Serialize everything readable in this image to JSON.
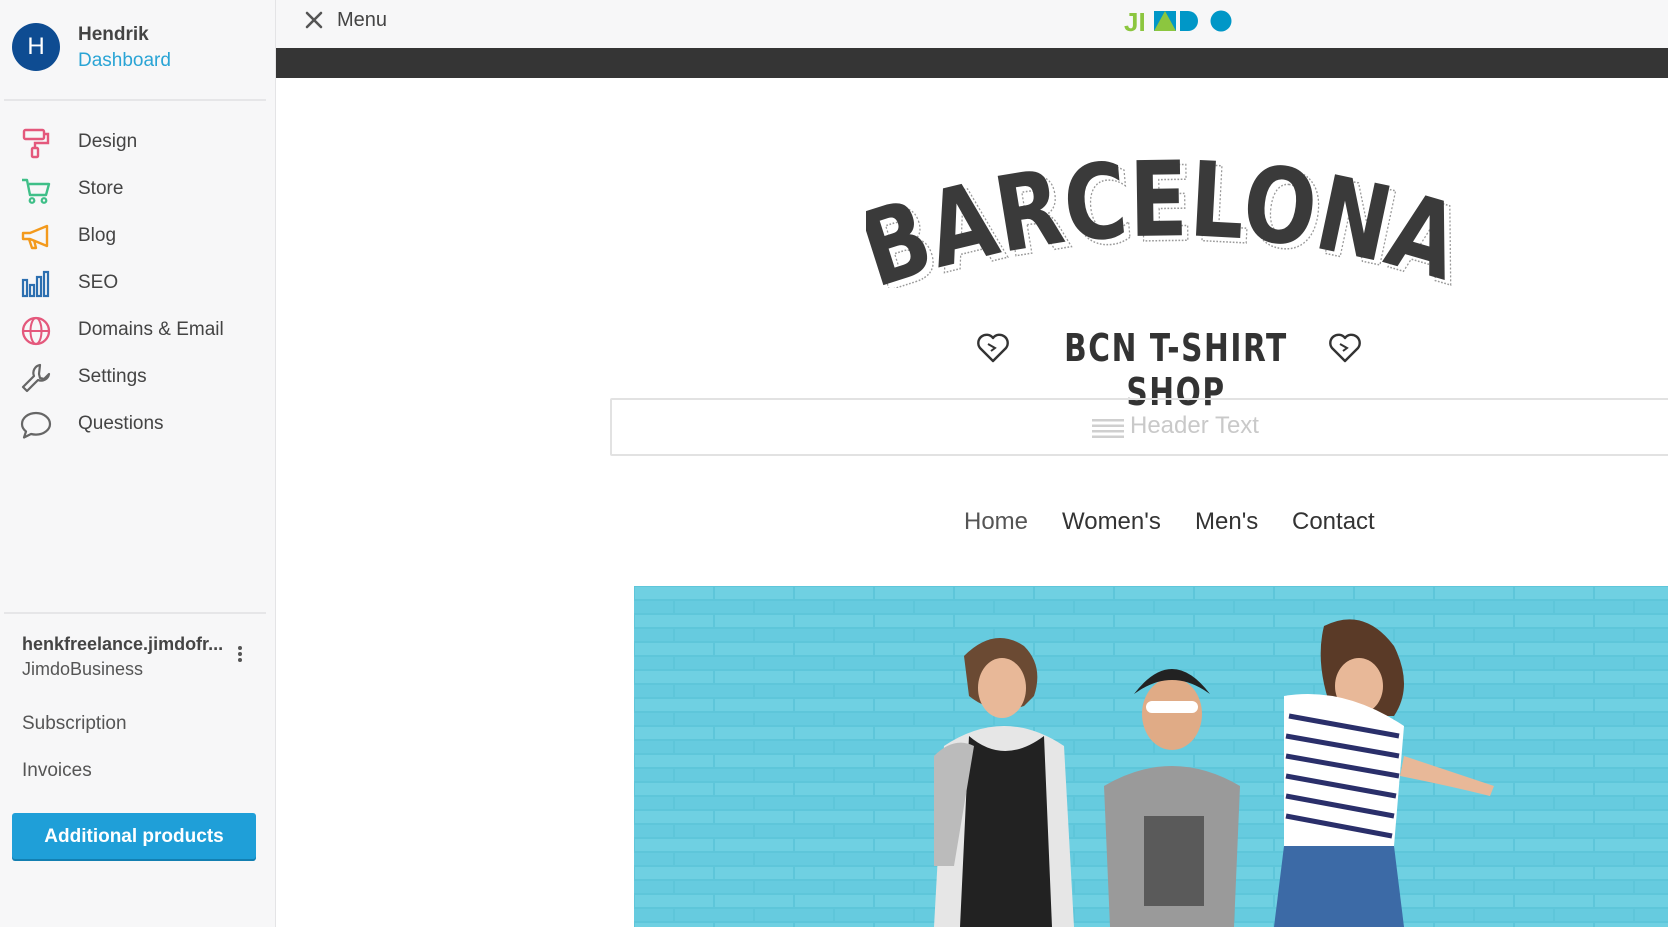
{
  "user": {
    "initial": "H",
    "name": "Hendrik",
    "link": "Dashboard"
  },
  "nav": [
    {
      "label": "Design",
      "icon": "paint-roller-icon",
      "color": "#e4587c"
    },
    {
      "label": "Store",
      "icon": "shopping-cart-icon",
      "color": "#3fbf88"
    },
    {
      "label": "Blog",
      "icon": "megaphone-icon",
      "color": "#f39a1d"
    },
    {
      "label": "SEO",
      "icon": "bar-chart-icon",
      "color": "#2c6fb0"
    },
    {
      "label": "Domains & Email",
      "icon": "globe-icon",
      "color": "#e4587c"
    },
    {
      "label": "Settings",
      "icon": "wrench-icon",
      "color": "#666666"
    },
    {
      "label": "Questions",
      "icon": "speech-bubble-icon",
      "color": "#666666"
    }
  ],
  "site": {
    "domain": "henkfreelance.jimdofr...",
    "plan": "JimdoBusiness"
  },
  "links": {
    "subscription": "Subscription",
    "invoices": "Invoices"
  },
  "cta": {
    "label": "Additional products",
    "color": "#1f9fd8"
  },
  "topbar": {
    "menu_label": "Menu",
    "logo_text": "JIMDO"
  },
  "website": {
    "title": "BARCELONA",
    "tagline": "BCN T-SHIRT SHOP",
    "header_placeholder": "Header Text",
    "nav": [
      "Home",
      "Women's",
      "Men's",
      "Contact"
    ]
  }
}
